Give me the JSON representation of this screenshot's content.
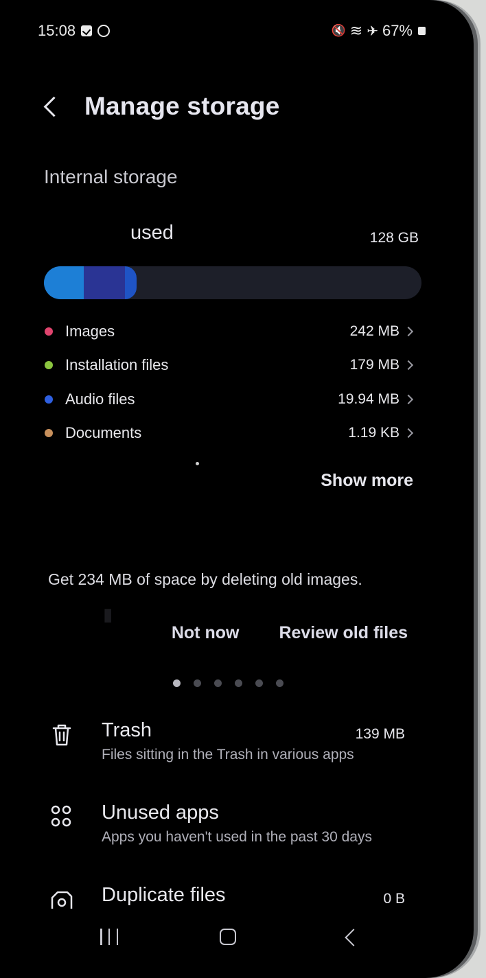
{
  "status_bar": {
    "time": "15:08",
    "icons_left": [
      "checkbox-notification-icon",
      "sync-notification-icon"
    ],
    "icons_right": [
      "mute-icon",
      "wifi-icon",
      "airplane-icon"
    ],
    "airplane_glyph": "✈",
    "mute_glyph": "🔇",
    "wifi_glyph": "≋",
    "battery": "67%"
  },
  "header": {
    "title": "Manage storage"
  },
  "storage": {
    "section_title": "Internal storage",
    "used_label": "used",
    "total": "128 GB",
    "segments": [
      {
        "name": "Images",
        "color": "#1d7fd6",
        "fraction": 0.105
      },
      {
        "name": "Installation files",
        "color": "#2a3494",
        "fraction": 0.11
      },
      {
        "name": "Audio files",
        "color": "#1f54c5",
        "fraction": 0.03
      }
    ],
    "track_color": "#1d1f29",
    "categories": [
      {
        "name": "Images",
        "size": "242 MB",
        "color": "#e0446e"
      },
      {
        "name": "Installation files",
        "size": "179 MB",
        "color": "#8bc53f"
      },
      {
        "name": "Audio files",
        "size": "19.94 MB",
        "color": "#2e5fe0"
      },
      {
        "name": "Documents",
        "size": "1.19 KB",
        "color": "#c8905c"
      }
    ],
    "show_more": "Show more"
  },
  "tip": {
    "text": "Get 234 MB of space by deleting old images.",
    "dismiss": "Not now",
    "action": "Review old files",
    "pager": {
      "count": 6,
      "active": 0
    }
  },
  "tools": [
    {
      "icon": "trash-icon",
      "title": "Trash",
      "desc": "Files sitting in the Trash in various apps",
      "size": "139 MB"
    },
    {
      "icon": "apps-grid-icon",
      "title": "Unused apps",
      "desc": "Apps you haven't used in the past 30 days",
      "size": ""
    },
    {
      "icon": "duplicate-files-icon",
      "title": "Duplicate files",
      "desc": "",
      "size": "0 B"
    }
  ],
  "nav": {
    "recents": "recents-icon",
    "home": "home-icon",
    "back": "back-icon"
  }
}
